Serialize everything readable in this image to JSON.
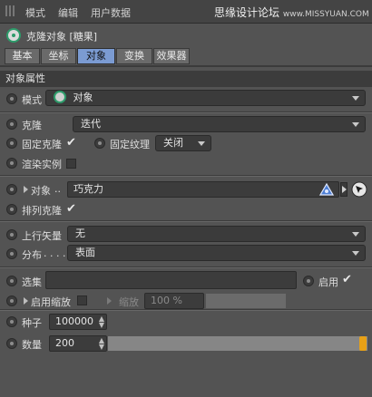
{
  "menu": {
    "items": [
      "模式",
      "编辑",
      "用户数据"
    ]
  },
  "watermark": {
    "main": "思缘设计论坛",
    "small": "www.MISSYUAN.COM"
  },
  "header": {
    "title": "克隆对象 [糖果]"
  },
  "tabs": [
    "基本",
    "坐标",
    "对象",
    "变换",
    "效果器"
  ],
  "active_tab": "对象",
  "section": {
    "title": "对象属性"
  },
  "fields": {
    "mode": {
      "label": "模式",
      "value": "对象"
    },
    "clone": {
      "label": "克隆",
      "value": "迭代"
    },
    "fix_clone": {
      "label": "固定克隆",
      "checked": true
    },
    "fix_texture": {
      "label": "固定纹理",
      "value": "关闭"
    },
    "render_instance": {
      "label": "渲染实例",
      "checked": false
    },
    "object": {
      "label": "对象",
      "dots": "..",
      "value": "巧克力"
    },
    "arrange_clone": {
      "label": "排列克隆",
      "checked": true
    },
    "up_vector": {
      "label": "上行矢量",
      "value": "无"
    },
    "distribution": {
      "label": "分布",
      "dots": ". . . .",
      "value": "表面"
    },
    "selection": {
      "label": "选集",
      "value": "",
      "enable_label": "启用",
      "enabled": true
    },
    "enable_scale": {
      "label": "启用缩放",
      "checked": false
    },
    "scale": {
      "label": "缩放",
      "value": "100 %"
    },
    "seed": {
      "label": "种子",
      "value": "100000"
    },
    "count": {
      "label": "数量",
      "value": "200",
      "fraction": 1.0
    }
  }
}
